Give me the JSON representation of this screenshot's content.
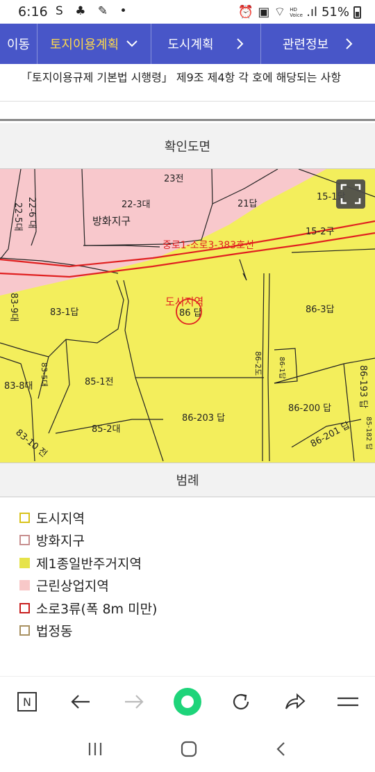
{
  "status": {
    "time": "6:16",
    "left_icons": "S ♣ ✎ •",
    "net_label": "HD Voice",
    "battery": "51%"
  },
  "nav": {
    "back": "이동",
    "active": "토지이용계획",
    "mid": "도시계획",
    "last": "관련정보"
  },
  "notice": "「토지이용규제 기본법 시행령」 제9조 제4항 각 호에 해당되는 사항",
  "map_section": {
    "title": "확인도면",
    "labels": {
      "p23": "23전",
      "p22_3": "22-3대",
      "p21": "21답",
      "p22_5": "22-5대",
      "p22_6": "22-6 대",
      "bh": "방화지구",
      "p15": "15-1답",
      "p15_2": "15-2구",
      "road": "중로1-소로3-383호선",
      "city": "도시지역",
      "p86": "86 답",
      "p83_9": "83-9대",
      "p83_1": "83-1답",
      "p86_3": "86-3답",
      "p83_8": "83-8대",
      "p83_5": "83-5대",
      "p85_1": "85-1전",
      "p86_2": "86-2도",
      "p86_1": "86-1답",
      "p86_193": "86-193 답",
      "p86_200": "86-200 답",
      "p85_2": "85-2대",
      "p86_203": "86-203 답",
      "p86_201": "86-201 답",
      "p83_10": "83-10 전",
      "p85_182": "85-182 답"
    }
  },
  "legend_section": {
    "title": "범례",
    "items": [
      {
        "label": "도시지역",
        "border": "#d8c21a",
        "fill": "#ffffff"
      },
      {
        "label": "방화지구",
        "border": "#c89090",
        "fill": "#ffffff"
      },
      {
        "label": "제1종일반주거지역",
        "border": "#e6e34a",
        "fill": "#e6e34a"
      },
      {
        "label": "근린상업지역",
        "border": "#f8c8c8",
        "fill": "#f8c8c8"
      },
      {
        "label": "소로3류(폭 8m 미만)",
        "border": "#c81e1e",
        "fill": "#ffffff"
      },
      {
        "label": "법정동",
        "border": "#a89060",
        "fill": "#ffffff"
      }
    ]
  },
  "browser": {
    "icons": [
      "naver-icon",
      "back-arrow-icon",
      "forward-arrow-icon",
      "home-dot-icon",
      "refresh-icon",
      "share-icon",
      "menu-icon"
    ]
  },
  "colors": {
    "nav_bg": "#4856c8",
    "nav_active": "#ffd94a",
    "map_yellow": "#f3ee5c",
    "map_pink": "#f8c8cc",
    "road_red": "#e02020",
    "accent_green": "#1ed47a"
  }
}
